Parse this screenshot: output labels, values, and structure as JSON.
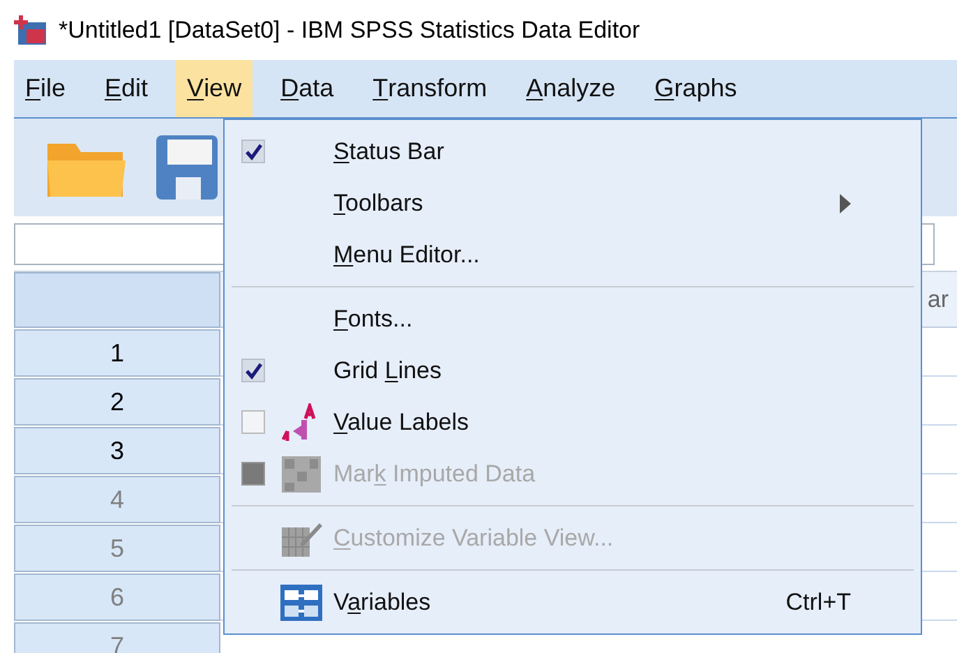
{
  "window": {
    "title": "*Untitled1 [DataSet0] - IBM SPSS Statistics Data Editor"
  },
  "menubar": [
    {
      "access_key": "F",
      "after": "ile",
      "selected": false
    },
    {
      "access_key": "E",
      "after": "dit",
      "selected": false
    },
    {
      "access_key": "V",
      "after": "iew",
      "selected": true
    },
    {
      "access_key": "D",
      "after": "ata",
      "selected": false
    },
    {
      "access_key": "T",
      "after": "ransform",
      "selected": false
    },
    {
      "access_key": "A",
      "after": "nalyze",
      "selected": false
    },
    {
      "access_key": "G",
      "after": "raphs",
      "selected": false
    }
  ],
  "grid": {
    "column_header": "ar",
    "rows": [
      {
        "label": "1",
        "greyed": false
      },
      {
        "label": "2",
        "greyed": false
      },
      {
        "label": "3",
        "greyed": false
      },
      {
        "label": "4",
        "greyed": true
      },
      {
        "label": "5",
        "greyed": true
      },
      {
        "label": "6",
        "greyed": true
      },
      {
        "label": "7",
        "greyed": true
      }
    ]
  },
  "view_menu": [
    {
      "kind": "check",
      "access_key": "S",
      "after": "tatus Bar",
      "checked": true,
      "disabled": false
    },
    {
      "kind": "submenu",
      "access_key": "T",
      "after": "oolbars",
      "disabled": false
    },
    {
      "kind": "plain",
      "access_key": "M",
      "after": "enu Editor...",
      "disabled": false
    },
    {
      "kind": "separator"
    },
    {
      "kind": "plain",
      "access_key": "F",
      "after": "onts...",
      "disabled": false
    },
    {
      "kind": "check",
      "before": "Grid ",
      "access_key": "L",
      "after": "ines",
      "checked": true,
      "disabled": false
    },
    {
      "kind": "labels",
      "access_key": "V",
      "after": "alue Labels",
      "checked": false,
      "disabled": false
    },
    {
      "kind": "imputed",
      "before": "Mar",
      "access_key": "k",
      "after": " Imputed Data",
      "checked": false,
      "disabled": true
    },
    {
      "kind": "separator"
    },
    {
      "kind": "customize",
      "access_key": "C",
      "after": "ustomize Variable View...",
      "disabled": true
    },
    {
      "kind": "separator"
    },
    {
      "kind": "variables",
      "before": "V",
      "access_key": "a",
      "after": "riables",
      "shortcut": "Ctrl+T",
      "disabled": false
    }
  ]
}
